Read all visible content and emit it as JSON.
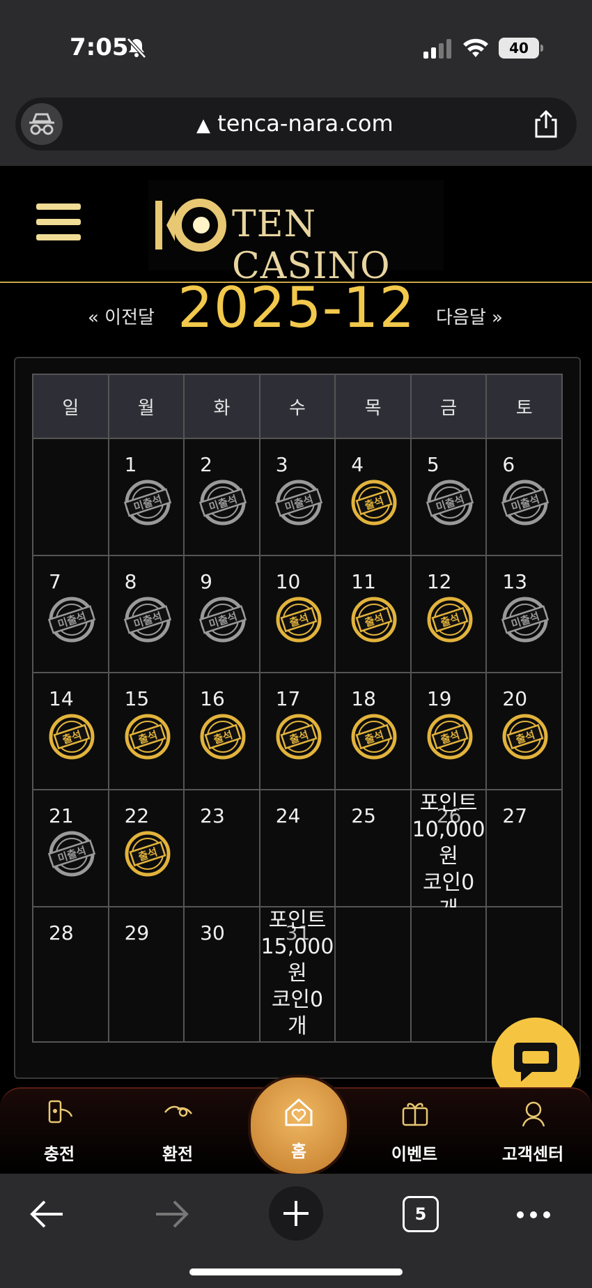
{
  "status_bar": {
    "time": "7:05",
    "battery": "40"
  },
  "browser": {
    "url": "tenca-nara.com",
    "tab_count": "5"
  },
  "site": {
    "logo_text": "TEN CASINO"
  },
  "month_nav": {
    "prev_label": "« 이전달",
    "title": "2025-12",
    "next_label": "다음달 »"
  },
  "calendar": {
    "weekdays": [
      "일",
      "월",
      "화",
      "수",
      "목",
      "금",
      "토"
    ],
    "weeks": [
      [
        {
          "day": "",
          "status": ""
        },
        {
          "day": "1",
          "status": "미출석"
        },
        {
          "day": "2",
          "status": "미출석"
        },
        {
          "day": "3",
          "status": "미출석"
        },
        {
          "day": "4",
          "status": "출석"
        },
        {
          "day": "5",
          "status": "미출석"
        },
        {
          "day": "6",
          "status": "미출석"
        }
      ],
      [
        {
          "day": "7",
          "status": "미출석"
        },
        {
          "day": "8",
          "status": "미출석"
        },
        {
          "day": "9",
          "status": "미출석"
        },
        {
          "day": "10",
          "status": "출석"
        },
        {
          "day": "11",
          "status": "출석"
        },
        {
          "day": "12",
          "status": "출석"
        },
        {
          "day": "13",
          "status": "미출석"
        }
      ],
      [
        {
          "day": "14",
          "status": "출석"
        },
        {
          "day": "15",
          "status": "출석"
        },
        {
          "day": "16",
          "status": "출석"
        },
        {
          "day": "17",
          "status": "출석"
        },
        {
          "day": "18",
          "status": "출석"
        },
        {
          "day": "19",
          "status": "출석"
        },
        {
          "day": "20",
          "status": "출석"
        }
      ],
      [
        {
          "day": "21",
          "status": "미출석"
        },
        {
          "day": "22",
          "status": "출석"
        },
        {
          "day": "23",
          "status": ""
        },
        {
          "day": "24",
          "status": ""
        },
        {
          "day": "25",
          "status": ""
        },
        {
          "day": "26",
          "status": "",
          "note": [
            "포인트",
            "10,000",
            "원",
            "코인0",
            "개"
          ]
        },
        {
          "day": "27",
          "status": ""
        }
      ],
      [
        {
          "day": "28",
          "status": ""
        },
        {
          "day": "29",
          "status": ""
        },
        {
          "day": "30",
          "status": ""
        },
        {
          "day": "31",
          "status": "",
          "note": [
            "포인트",
            "15,000",
            "원",
            "코인0",
            "개"
          ]
        },
        {
          "day": "",
          "status": ""
        },
        {
          "day": "",
          "status": ""
        },
        {
          "day": "",
          "status": ""
        }
      ]
    ]
  },
  "bottom_nav": {
    "items": [
      {
        "label": "충전",
        "icon": "charge-icon"
      },
      {
        "label": "환전",
        "icon": "exchange-icon"
      },
      {
        "label": "홈",
        "icon": "home-heart-icon"
      },
      {
        "label": "이벤트",
        "icon": "gift-icon"
      },
      {
        "label": "고객센터",
        "icon": "support-icon"
      }
    ]
  },
  "colors": {
    "gold": "#f2c94c",
    "sunday": "#e2473a",
    "saturday": "#6bb6ee",
    "stamp_gold": "#e2b33c",
    "stamp_gray": "#9a9a9a"
  }
}
